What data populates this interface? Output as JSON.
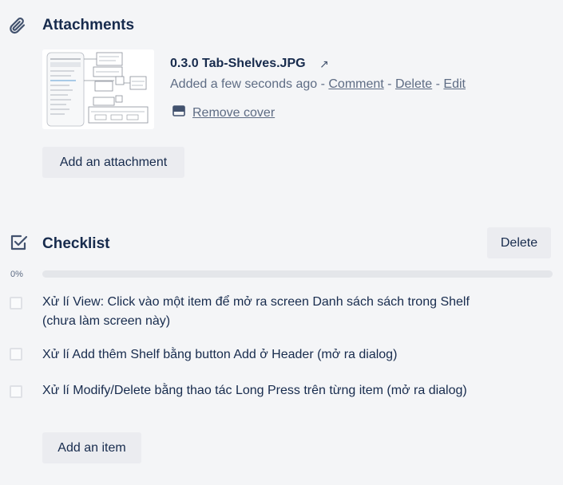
{
  "attachments": {
    "title": "Attachments",
    "icon": "paperclip-icon",
    "items": [
      {
        "filename": "0.3.0 Tab-Shelves.JPG",
        "open_icon": "↗",
        "added": "Added a few seconds ago",
        "separator": " - ",
        "comment": "Comment",
        "delete": "Delete",
        "edit": "Edit",
        "remove_cover": "Remove cover"
      }
    ],
    "add_button": "Add an attachment"
  },
  "checklist": {
    "title": "Checklist",
    "icon": "checkbox-icon",
    "delete_button": "Delete",
    "progress_label": "0%",
    "progress": 0,
    "progress_color": "#5aac44",
    "items": [
      {
        "text": "Xử lí View: Click vào một item để mở ra screen Danh sách sách trong Shelf (chưa làm screen này)",
        "checked": false
      },
      {
        "text": "Xử lí Add thêm Shelf bằng button Add ở Header (mở ra dialog)",
        "checked": false
      },
      {
        "text": "Xử lí Modify/Delete bằng thao tác Long Press trên từng item (mở ra dialog)",
        "checked": false
      }
    ],
    "add_button": "Add an item"
  },
  "colors": {
    "background": "#f4f5f7",
    "button_bg": "#ebecf0",
    "text": "#172b4d",
    "muted": "#5e6c84"
  }
}
